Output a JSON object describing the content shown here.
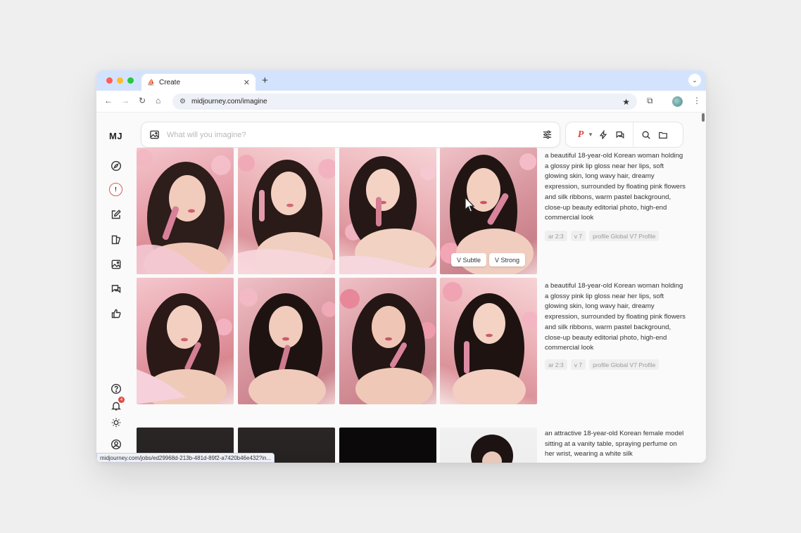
{
  "browser": {
    "tab": {
      "title": "Create",
      "favicon": "sailboat-icon"
    },
    "url": "midjourney.com/imagine",
    "status_url": "midjourney.com/jobs/ed29968d-213b-481d-89f2-a7420b46e432?in..."
  },
  "sidebar": {
    "logo": "MJ",
    "items": [
      {
        "name": "explore",
        "icon": "compass-icon"
      },
      {
        "name": "create",
        "icon": "create-icon",
        "label": "!"
      },
      {
        "name": "edit",
        "icon": "edit-icon"
      },
      {
        "name": "personalize",
        "icon": "personalize-icon"
      },
      {
        "name": "organize",
        "icon": "image-icon"
      },
      {
        "name": "chat",
        "icon": "chat-icon"
      },
      {
        "name": "tasks",
        "icon": "thumbs-up-icon"
      }
    ],
    "bottom": [
      {
        "name": "help",
        "icon": "help-icon"
      },
      {
        "name": "updates",
        "icon": "bell-icon",
        "badge": "4"
      },
      {
        "name": "theme",
        "icon": "sun-icon"
      },
      {
        "name": "account",
        "icon": "account-icon"
      }
    ]
  },
  "prompt_bar": {
    "placeholder": "What will you imagine?"
  },
  "tools": {
    "personalize_label": "P"
  },
  "jobs": [
    {
      "prompt": "a beautiful 18-year-old Korean woman holding a glossy pink lip gloss near her lips, soft glowing skin, long wavy hair, dreamy expression, surrounded by floating pink flowers and silk ribbons, warm pastel background, close-up beauty editorial photo, high-end commercial look",
      "chips": [
        "ar 2:3",
        "v 7",
        "profile Global V7 Profile"
      ],
      "vary_buttons": [
        "V Subtle",
        "V Strong"
      ]
    },
    {
      "prompt": "a beautiful 18-year-old Korean woman holding a glossy pink lip gloss near her lips, soft glowing skin, long wavy hair, dreamy expression, surrounded by floating pink flowers and silk ribbons, warm pastel background, close-up beauty editorial photo, high-end commercial look",
      "chips": [
        "ar 2:3",
        "v 7",
        "profile Global V7 Profile"
      ]
    },
    {
      "prompt": "an attractive 18-year-old Korean female model sitting at a vanity table, spraying perfume on her wrist, wearing a white silk"
    }
  ],
  "colors": {
    "accent": "#e0483f",
    "tab_strip": "#d3e3fd",
    "page_bg": "#fafafa"
  }
}
